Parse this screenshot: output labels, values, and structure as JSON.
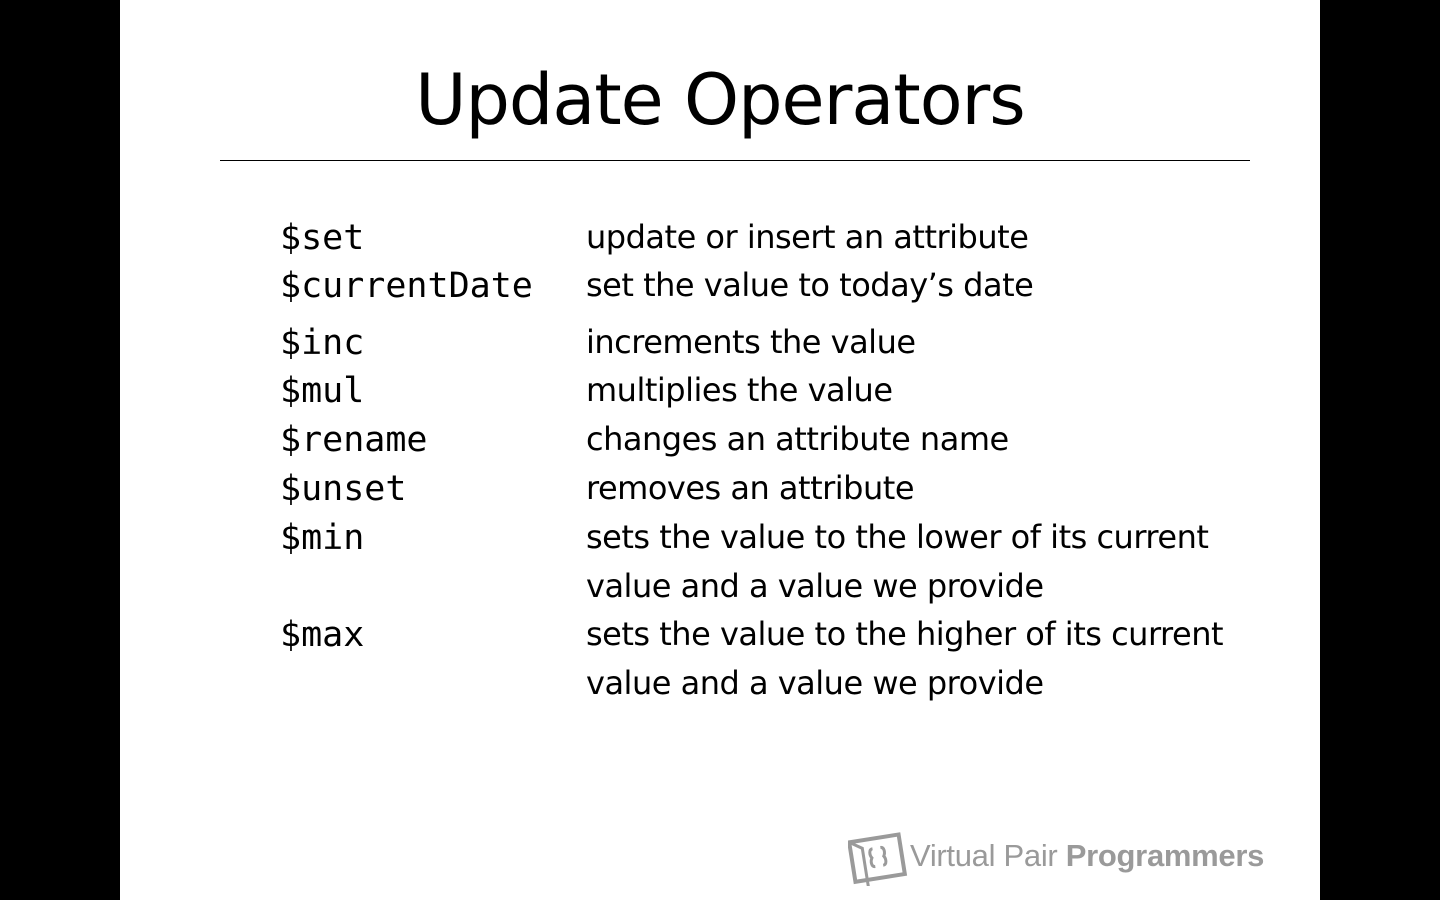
{
  "slide": {
    "title": "Update Operators",
    "operators": [
      {
        "name": "$set",
        "description": [
          "update or insert an attribute"
        ]
      },
      {
        "name": "$currentDate",
        "description": [
          "set the value to today’s date"
        ]
      },
      {
        "name": "$inc",
        "description": [
          "increments the value"
        ]
      },
      {
        "name": "$mul",
        "description": [
          "multiplies the value"
        ]
      },
      {
        "name": "$rename",
        "description": [
          "changes an attribute name"
        ]
      },
      {
        "name": "$unset",
        "description": [
          "removes an attribute"
        ]
      },
      {
        "name": "$min",
        "description": [
          "sets the value to the lower of its current",
          "value and a value we provide"
        ]
      },
      {
        "name": "$max",
        "description": [
          "sets the value to the higher of its current",
          "value and a value we provide"
        ]
      }
    ]
  },
  "branding": {
    "name_light": "Virtual Pair ",
    "name_bold": "Programmers",
    "icon": "virtual-pair-programmers-logo-icon"
  },
  "colors": {
    "background": "#000000",
    "slide": "#ffffff",
    "text": "#000000",
    "logo": "#9a9a9a"
  }
}
